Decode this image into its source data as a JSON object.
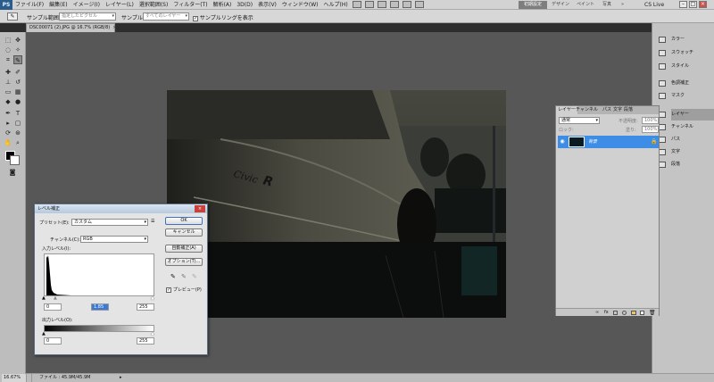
{
  "app": {
    "logo": "PS",
    "menus": [
      "ファイル(F)",
      "編集(E)",
      "イメージ(I)",
      "レイヤー(L)",
      "選択範囲(S)",
      "フィルター(T)",
      "解析(A)",
      "3D(D)",
      "表示(V)",
      "ウィンドウ(W)",
      "ヘルプ(H)"
    ],
    "workspace_active": "初期設定",
    "workspaces": [
      "デザイン",
      "ペイント",
      "写真"
    ],
    "cs_live": "CS Live",
    "win_min": "–",
    "win_max": "□",
    "win_close": "×"
  },
  "options_bar": {
    "sample_size_label": "サンプル範囲:",
    "sample_size_value": "指定したピクセル",
    "sample_label": "サンプル:",
    "sample_value": "すべてのレイヤー",
    "show_ring_label": "サンプルリングを表示",
    "show_ring_checked": true
  },
  "document": {
    "tab_title": "DSC00071 (2).JPG @ 16.7% (RGB/8)",
    "tab_close": "×"
  },
  "status": {
    "zoom": "16.67%",
    "file_info": "ファイル : 45.9M/45.9M"
  },
  "dock": {
    "items": [
      "カラー",
      "スウォッチ",
      "スタイル",
      "色調補正",
      "マスク",
      "レイヤー",
      "チャンネル",
      "パス",
      "文字",
      "段落"
    ]
  },
  "layers_panel": {
    "tabs": [
      "レイヤー",
      "チャンネル",
      "パス",
      "文字",
      "段落"
    ],
    "blend_mode": "通常",
    "opacity_label": "不透明度:",
    "opacity_value": "100%",
    "lock_label": "ロック:",
    "fill_label": "塗り:",
    "fill_value": "100%",
    "layer_name": "背景",
    "footer_icons": [
      "link-icon",
      "fx-icon",
      "mask-icon",
      "adjustment-icon",
      "group-icon",
      "new-layer-icon",
      "trash-icon"
    ]
  },
  "levels_dialog": {
    "title": "レベル補正",
    "preset_label": "プリセット(E):",
    "preset_value": "カスタム",
    "channel_label": "チャンネル(C):",
    "channel_value": "RGB",
    "input_label": "入力レベル(I):",
    "input_black": "0",
    "input_gamma": "1.85",
    "input_white": "255",
    "output_label": "出力レベル(O):",
    "output_black": "0",
    "output_white": "255",
    "ok": "OK",
    "cancel": "キャンセル",
    "auto": "自動補正(A)",
    "options": "オプション(T)...",
    "preview_label": "プレビュー(P)",
    "preview_checked": true,
    "close": "×"
  }
}
